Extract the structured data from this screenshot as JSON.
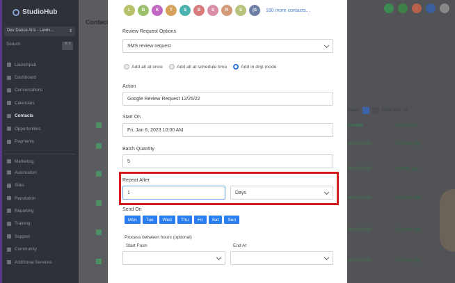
{
  "sidebar": {
    "logo": "StudioHub",
    "account": "Dev Dance Arts - Lewis...",
    "search": "Search",
    "search_kbd": "⌘ K",
    "items": [
      {
        "label": "Launchpad"
      },
      {
        "label": "Dashboard"
      },
      {
        "label": "Conversations"
      },
      {
        "label": "Calendars"
      },
      {
        "label": "Contacts"
      },
      {
        "label": "Opportunities"
      },
      {
        "label": "Payments"
      },
      {
        "label": "Marketing"
      },
      {
        "label": "Automation"
      },
      {
        "label": "Sites"
      },
      {
        "label": "Reputation"
      },
      {
        "label": "Reporting"
      },
      {
        "label": "Training"
      },
      {
        "label": "Support"
      },
      {
        "label": "Community"
      },
      {
        "label": "Additional Services"
      }
    ]
  },
  "background": {
    "contacts_title": "Contact",
    "pager_label": "Pages",
    "page_size": "Page Size: 20",
    "col_created": "Created",
    "col_activity": "Last Activity",
    "rows": [
      {
        "date": "Nov 13 2021",
        "time": "08:37 AM",
        "ago": "7 months ago"
      },
      {
        "date": "Nov 13 2021",
        "time": "08:37 AM",
        "ago": "4 weeks ago"
      },
      {
        "date": "Nov 13 2021",
        "time": "08:37 AM",
        "ago": "7 months ago"
      },
      {
        "date": "Nov 13 2021",
        "time": "08:37 AM",
        "ago": "7 months ago"
      },
      {
        "date": "Nov 13 2021",
        "time": "08:37 AM",
        "ago": "7 months ago"
      }
    ]
  },
  "modal": {
    "avatars": [
      {
        "letter": "L",
        "color": "#b8c26a"
      },
      {
        "letter": "B",
        "color": "#9cc06c"
      },
      {
        "letter": "K",
        "color": "#c169c2"
      },
      {
        "letter": "T",
        "color": "#d6a15a"
      },
      {
        "letter": "S",
        "color": "#4ab3b0"
      },
      {
        "letter": "B",
        "color": "#d97c7c"
      },
      {
        "letter": "S",
        "color": "#d98da9"
      },
      {
        "letter": "R",
        "color": "#d29a76"
      },
      {
        "letter": "S",
        "color": "#b7c27a"
      },
      {
        "letter": "(S",
        "color": "#6e7fa6"
      }
    ],
    "more_contacts": "180 more contacts...",
    "review_options_label": "Review Request Options",
    "review_options_value": "SMS review request",
    "radio_add_all": "Add all at once",
    "radio_schedule": "Add all at schedule time",
    "radio_drip": "Add in drip mode",
    "action_label": "Action",
    "action_value": "Google Review Request 12/26/22",
    "start_on_label": "Start On",
    "start_on_value": "Fri, Jan 6, 2023 10:00 AM",
    "batch_label": "Batch Quantity",
    "batch_value": "5",
    "repeat_label": "Repeat After",
    "repeat_value": "1",
    "repeat_unit": "Days",
    "send_on_label": "Send On",
    "days": [
      "Mon",
      "Tue",
      "Wed",
      "Thu",
      "Fri",
      "Sat",
      "Sun"
    ],
    "process_label": "Process between hours (optional)",
    "start_from_label": "Start From",
    "end_at_label": "End At"
  },
  "colors": {
    "accent": "#2a7ef0",
    "highlight": "#d41c1c"
  }
}
